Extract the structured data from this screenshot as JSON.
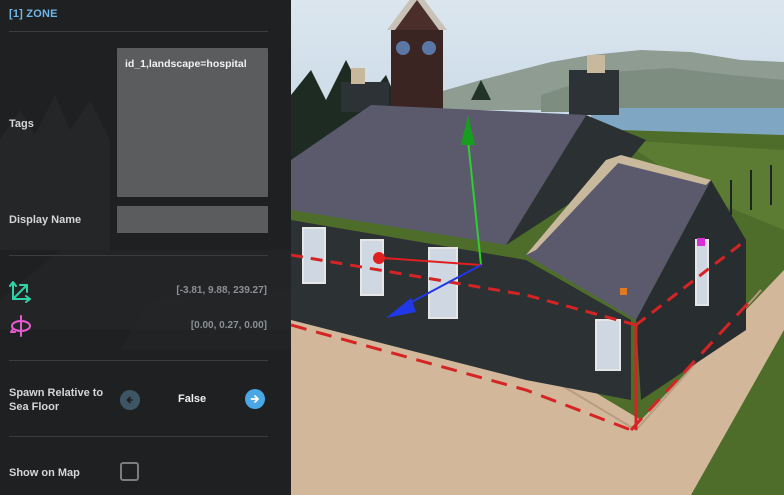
{
  "panel": {
    "title": "[1] ZONE",
    "tags": {
      "label": "Tags",
      "value": "id_1,landscape=hospital"
    },
    "display_name": {
      "label": "Display Name",
      "value": ""
    },
    "position": {
      "icon": "move-axes-icon",
      "value": "[-3.81, 9.88, 239.27]"
    },
    "rotation": {
      "icon": "rotate-icon",
      "value": "[0.00, 0.27, 0.00]"
    },
    "spawn_relative": {
      "label": "Spawn Relative to Sea Floor",
      "value": "False"
    },
    "show_on_map": {
      "label": "Show on Map",
      "checked": false
    }
  },
  "colors": {
    "title_accent": "#6fb7e8",
    "position_icon": "#2fd3a8",
    "rotation_icon": "#e85bd0",
    "toggle_active": "#4aa7e6",
    "zone_outline": "#d42424"
  }
}
